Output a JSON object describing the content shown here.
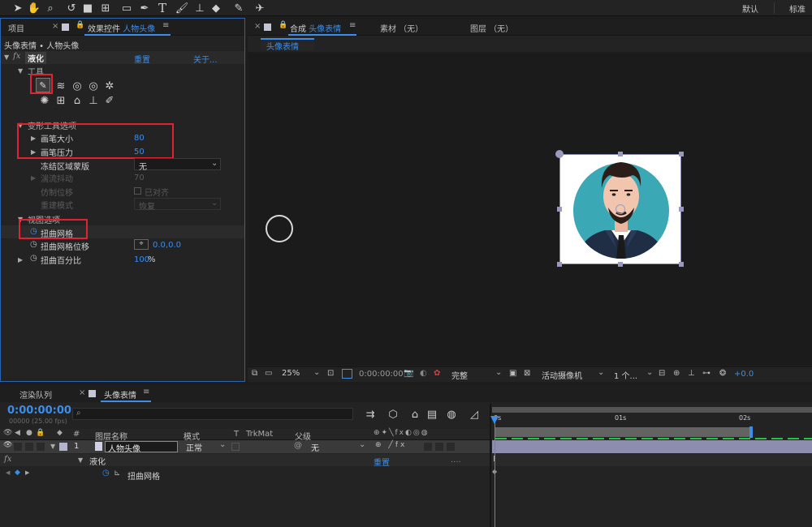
{
  "top_bar": {
    "workspace_default": "默认",
    "workspace_standard": "标准"
  },
  "left_panel": {
    "tab_project": "项目",
    "tab_effects_prefix": "效果控件",
    "tab_effects_layer": "人物头像",
    "breadcrumb": "头像表情 • 人物头像",
    "effect_name": "液化",
    "reset": "重置",
    "about": "关于...",
    "tools_label": "工具",
    "warp_options": "变形工具选项",
    "brush_size_label": "画笔大小",
    "brush_size_value": "80",
    "brush_pressure_label": "画笔压力",
    "brush_pressure_value": "50",
    "freeze_label": "冻结区域蒙版",
    "freeze_value": "无",
    "turbulent_jitter_label": "湍流抖动",
    "turbulent_jitter_value": "70",
    "clone_offset_label": "仿制位移",
    "clone_offset_value": "已对齐",
    "reconstruct_label": "重建模式",
    "reconstruct_value": "恢复",
    "view_options": "视图选项",
    "distort_mesh": "扭曲网格",
    "distort_mesh_offset": "扭曲网格位移",
    "distort_mesh_offset_value": "0.0,0.0",
    "distort_percent_label": "扭曲百分比",
    "distort_percent_value": "100",
    "percent_sign": "%"
  },
  "comp_panel": {
    "tab_comp_prefix": "合成",
    "tab_comp_name": "头像表情",
    "tab_footage": "素材 （无）",
    "tab_layer": "图层 （无）",
    "sub_tab": "头像表情",
    "zoom": "25%",
    "timecode": "0:00:00:00",
    "resolution": "完整",
    "camera": "活动摄像机",
    "views": "1 个...",
    "exposure": "+0.0"
  },
  "timeline": {
    "tab_render_queue": "渲染队列",
    "tab_comp": "头像表情",
    "timecode": "0:00:00:00",
    "fps": "00000 (25.00 fps)",
    "col_num": "#",
    "col_layer_name": "图层名称",
    "col_mode": "模式",
    "col_t": "T",
    "col_trkmat": "TrkMat",
    "col_parent": "父级",
    "layer_num": "1",
    "layer_name": "人物头像",
    "layer_mode": "正常",
    "layer_parent": "无",
    "effect_row_name": "液化",
    "effect_row_reset": "重置",
    "effect_row_more": "....",
    "mesh_row": "扭曲网格",
    "ruler_0": "0s",
    "ruler_1": "01s",
    "ruler_2": "02s"
  },
  "colors": {
    "accent_blue": "#3b8eea",
    "highlight_red": "#e0242f",
    "avatar_teal": "#3ba8b5"
  }
}
